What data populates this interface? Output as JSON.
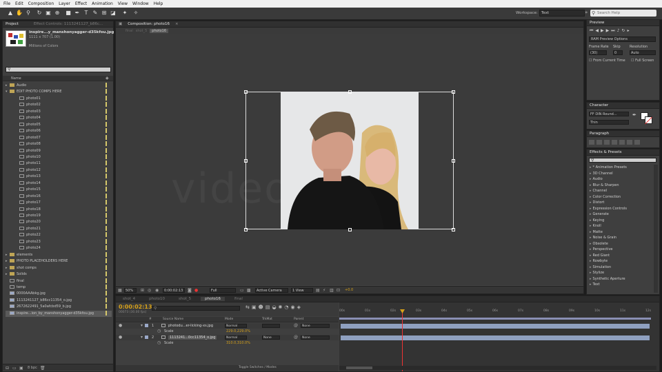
{
  "menubar": {
    "items": [
      "File",
      "Edit",
      "Composition",
      "Layer",
      "Effect",
      "Animation",
      "View",
      "Window",
      "Help"
    ]
  },
  "toolbar": {
    "workspace_label": "Workspace:",
    "workspace_value": "Text",
    "search_placeholder": "Search Help"
  },
  "project": {
    "tabs": [
      "Project",
      "Effect Controls: 1113241127_b86c...jpg"
    ],
    "item_name": "inspire...y_manshonyagger-d35kfou.jpg",
    "item_size": "1111 x 707 (1.00)",
    "item_desc": "Millions of Colors",
    "name_header": "Name",
    "items": [
      {
        "tri": "▸",
        "name": "Audio",
        "icon": "folder",
        "sel": false
      },
      {
        "tri": "▾",
        "name": "EDIT PHOTO COMPS HERE",
        "icon": "folder",
        "sel": false
      },
      {
        "tri": "",
        "name": "photo01",
        "icon": "comp",
        "sel": false,
        "indent": true
      },
      {
        "tri": "",
        "name": "photo02",
        "icon": "comp",
        "sel": false,
        "indent": true
      },
      {
        "tri": "",
        "name": "photo03",
        "icon": "comp",
        "sel": false,
        "indent": true
      },
      {
        "tri": "",
        "name": "photo04",
        "icon": "comp",
        "sel": false,
        "indent": true
      },
      {
        "tri": "",
        "name": "photo05",
        "icon": "comp",
        "sel": false,
        "indent": true
      },
      {
        "tri": "",
        "name": "photo06",
        "icon": "comp",
        "sel": false,
        "indent": true
      },
      {
        "tri": "",
        "name": "photo07",
        "icon": "comp",
        "sel": false,
        "indent": true
      },
      {
        "tri": "",
        "name": "photo08",
        "icon": "comp",
        "sel": false,
        "indent": true
      },
      {
        "tri": "",
        "name": "photo09",
        "icon": "comp",
        "sel": false,
        "indent": true
      },
      {
        "tri": "",
        "name": "photo10",
        "icon": "comp",
        "sel": false,
        "indent": true
      },
      {
        "tri": "",
        "name": "photo11",
        "icon": "comp",
        "sel": false,
        "indent": true
      },
      {
        "tri": "",
        "name": "photo12",
        "icon": "comp",
        "sel": false,
        "indent": true
      },
      {
        "tri": "",
        "name": "photo13",
        "icon": "comp",
        "sel": false,
        "indent": true
      },
      {
        "tri": "",
        "name": "photo14",
        "icon": "comp",
        "sel": false,
        "indent": true
      },
      {
        "tri": "",
        "name": "photo15",
        "icon": "comp",
        "sel": false,
        "indent": true
      },
      {
        "tri": "",
        "name": "photo16",
        "icon": "comp",
        "sel": false,
        "indent": true
      },
      {
        "tri": "",
        "name": "photo17",
        "icon": "comp",
        "sel": false,
        "indent": true
      },
      {
        "tri": "",
        "name": "photo18",
        "icon": "comp",
        "sel": false,
        "indent": true
      },
      {
        "tri": "",
        "name": "photo19",
        "icon": "comp",
        "sel": false,
        "indent": true
      },
      {
        "tri": "",
        "name": "photo20",
        "icon": "comp",
        "sel": false,
        "indent": true
      },
      {
        "tri": "",
        "name": "photo21",
        "icon": "comp",
        "sel": false,
        "indent": true
      },
      {
        "tri": "",
        "name": "photo22",
        "icon": "comp",
        "sel": false,
        "indent": true
      },
      {
        "tri": "",
        "name": "photo23",
        "icon": "comp",
        "sel": false,
        "indent": true
      },
      {
        "tri": "",
        "name": "photo24",
        "icon": "comp",
        "sel": false,
        "indent": true
      },
      {
        "tri": "▸",
        "name": "elements",
        "icon": "folder",
        "sel": false
      },
      {
        "tri": "▸",
        "name": "PHOTO PLACEHOLDERS HERE",
        "icon": "folder",
        "sel": false
      },
      {
        "tri": "▸",
        "name": "shot comps",
        "icon": "folder",
        "sel": false
      },
      {
        "tri": "▸",
        "name": "Solids",
        "icon": "folder",
        "sel": false
      },
      {
        "tri": "",
        "name": "final",
        "icon": "comp",
        "sel": false
      },
      {
        "tri": "",
        "name": "temp",
        "icon": "comp",
        "sel": false
      },
      {
        "tri": "",
        "name": "0000AAAbkg.jpg",
        "icon": "img",
        "sel": false
      },
      {
        "tri": "",
        "name": "1113241127_b86cc11354_o.jpg",
        "icon": "img",
        "sel": false
      },
      {
        "tri": "",
        "name": "2672622491_5a0afcbd59_b.jpg",
        "icon": "img",
        "sel": false
      },
      {
        "tri": "",
        "name": "inspire...ion_by_manshonyagger-d35kfou.jpg",
        "icon": "img",
        "sel": true
      }
    ],
    "bpc": "8 bpc"
  },
  "composition": {
    "tab_label": "Composition: photo16",
    "breadcrumb": [
      "final",
      "shot_5",
      "photo16"
    ],
    "zoom": "50%",
    "timecode": "0:00:02:13",
    "resolution": "Full",
    "camera": "Active Camera",
    "view": "1 View",
    "offset": "+0.0",
    "watermark": "videohive"
  },
  "preview": {
    "title": "Preview",
    "ram_options": "RAM Preview Options",
    "frame_rate_label": "Frame Rate",
    "skip_label": "Skip",
    "resolution_label": "Resolution",
    "frame_rate_value": "(30)",
    "skip_value": "0",
    "resolution_value": "Auto",
    "from_current": "From Current Time",
    "full_screen": "Full Screen"
  },
  "character": {
    "title": "Character",
    "font": "FF DIN Round...",
    "style": "Thin"
  },
  "paragraph": {
    "title": "Paragraph"
  },
  "effects": {
    "title": "Effects & Presets",
    "items": [
      "* Animation Presets",
      "3D Channel",
      "Audio",
      "Blur & Sharpen",
      "Channel",
      "Color Correction",
      "Distort",
      "Expression Controls",
      "Generate",
      "Keying",
      "Knoll",
      "Matte",
      "Noise & Grain",
      "Obsolete",
      "Perspective",
      "Red Giant",
      "Rowbyte",
      "Simulation",
      "Stylize",
      "Synthetic Aperture",
      "Text"
    ]
  },
  "timeline": {
    "tabs": [
      "shot_4",
      "photo10",
      "shot_5",
      "photo16",
      "final"
    ],
    "active_tab": 3,
    "timecode": "0:00:02:13",
    "frames": "00073 (30.00 fps)",
    "columns": {
      "num": "#",
      "source": "Source Name",
      "mode": "Mode",
      "trkmat": "TrkMat",
      "parent": "Parent"
    },
    "layers": [
      {
        "num": "1",
        "name": "photodu...er-licking-xs.jpg",
        "mode": "Normal",
        "trkmat": "",
        "parent": "None",
        "prop": "Scale",
        "prop_value": "229.0,229.0%"
      },
      {
        "num": "2",
        "name": "1113241...0cc11354_o.jpg",
        "mode": "Normal",
        "trkmat": "None",
        "parent": "None",
        "prop": "Scale",
        "prop_value": "310.0,310.0%"
      }
    ],
    "ruler": [
      "00s",
      "01s",
      "02s",
      "03s",
      "04s",
      "05s",
      "06s",
      "07s",
      "08s",
      "09s",
      "10s",
      "11s",
      "12s"
    ],
    "toggle_label": "Toggle Switches / Modes"
  },
  "colors": {
    "label_yellow": "#d6c86a",
    "playhead": "#e33",
    "timecode": "#d6a11a",
    "work_area": "#8a8fb4",
    "track": "#8fa0c0"
  }
}
